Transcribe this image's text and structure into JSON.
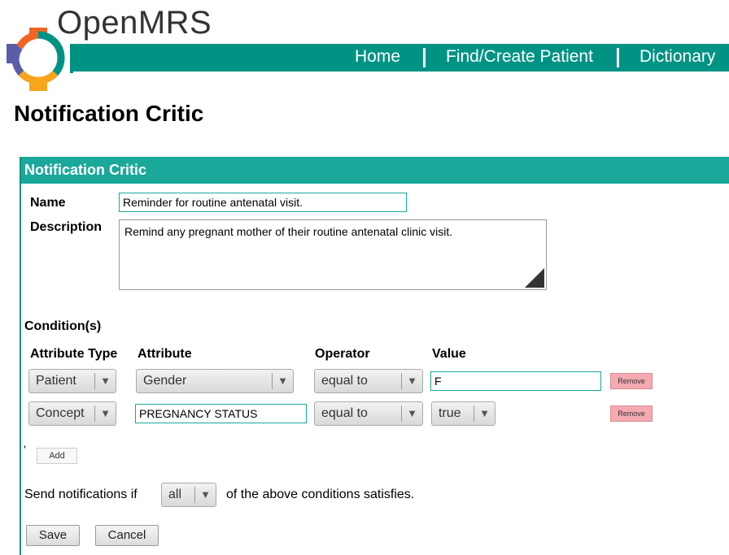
{
  "brand": {
    "name": "OpenMRS"
  },
  "nav": [
    {
      "label": "Home"
    },
    {
      "label": "Find/Create Patient"
    },
    {
      "label": "Dictionary"
    }
  ],
  "page_title": "Notification Critic",
  "form": {
    "header": "Notification Critic",
    "name_label": "Name",
    "name_value": "Reminder for routine antenatal visit.",
    "description_label": "Description",
    "description_value": "Remind any pregnant mother of their routine antenatal clinic visit.",
    "conditions_label": "Condition(s)",
    "columns": [
      "Attribute Type",
      "Attribute",
      "Operator",
      "Value"
    ],
    "conditions": [
      {
        "attribute_type": "Patient",
        "attribute": "Gender",
        "operator": "equal to",
        "value": "F",
        "remove_label": "Remove"
      },
      {
        "attribute_type": "Concept",
        "attribute": "PREGNANCY STATUS",
        "operator": "equal to",
        "value": "true",
        "remove_label": "Remove"
      }
    ],
    "stray_mark": "'",
    "add_label": "Add",
    "send_prefix": "Send notifications if",
    "send_select": "all",
    "send_suffix": "of the above conditions satisfies.",
    "save_label": "Save",
    "cancel_label": "Cancel"
  },
  "colors": {
    "brand_teal": "#009384",
    "header_teal": "#1aa89a",
    "remove_pink": "#f5a9b0"
  },
  "icons": {
    "dropdown": "chevron-down-icon",
    "resize": "resize-grip-icon"
  }
}
